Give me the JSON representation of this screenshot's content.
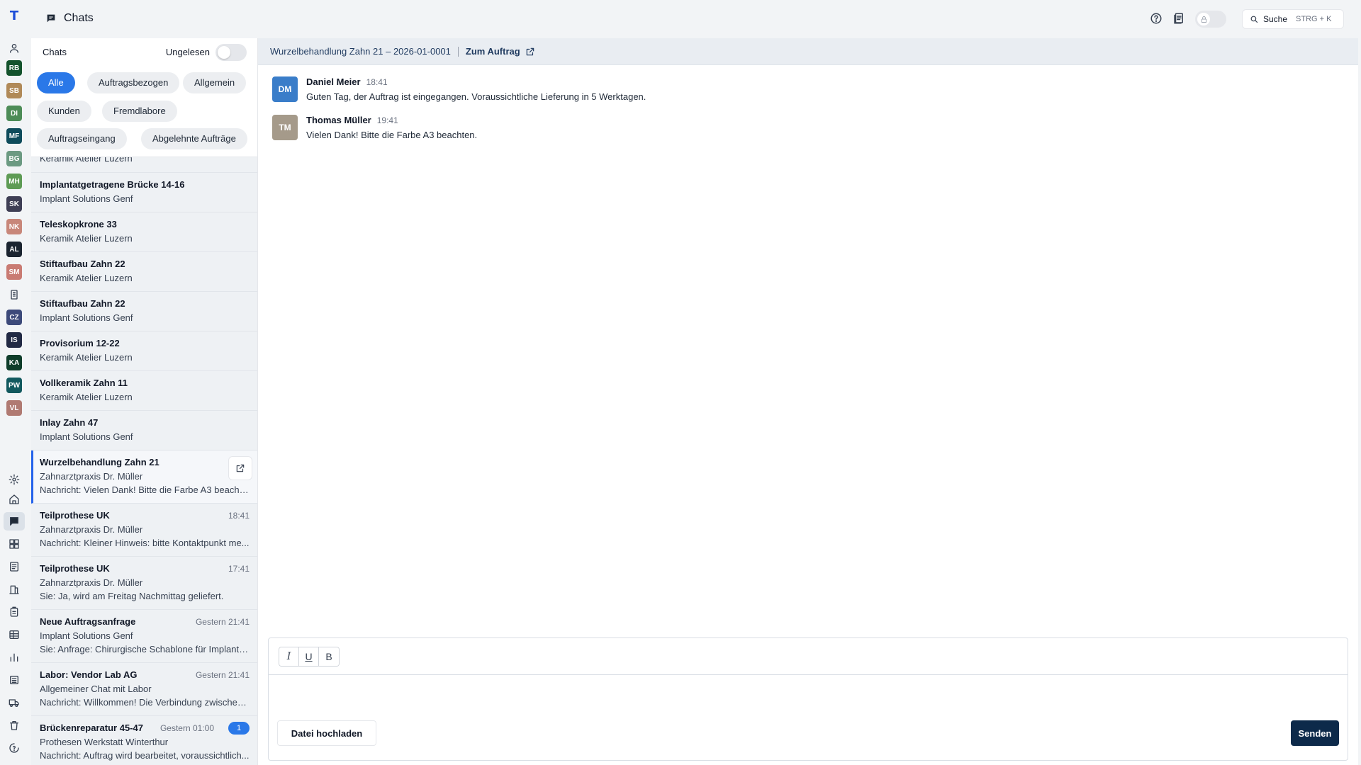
{
  "app": {
    "logo_letter": "T"
  },
  "header": {
    "title": "Chats",
    "search_label": "Suche",
    "search_shortcut": "STRG + K"
  },
  "rail": {
    "avatars": [
      {
        "initials": "RB",
        "color": "#14532d",
        "dot": false
      },
      {
        "initials": "SB",
        "color": "#b08958",
        "dot": false
      },
      {
        "initials": "DI",
        "color": "#4d8c57",
        "dot": false
      },
      {
        "initials": "MF",
        "color": "#0f4c5c",
        "dot": false
      },
      {
        "initials": "BG",
        "color": "#6c9a82",
        "dot": false
      },
      {
        "initials": "MH",
        "color": "#5e9b54",
        "dot": false
      },
      {
        "initials": "SK",
        "color": "#3f3f55",
        "dot": false
      },
      {
        "initials": "NK",
        "color": "#c8877a",
        "dot": false
      },
      {
        "initials": "AL",
        "color": "#1b2430",
        "dot": false
      },
      {
        "initials": "SM",
        "color": "#c97b73",
        "dot": false
      },
      {
        "initials": "CZ",
        "color": "#3d4a7a",
        "dot": false
      },
      {
        "initials": "IS",
        "color": "#222a44",
        "dot": true
      },
      {
        "initials": "KA",
        "color": "#0f3d2a",
        "dot": true
      },
      {
        "initials": "PW",
        "color": "#12595e",
        "dot": true
      },
      {
        "initials": "VL",
        "color": "#b07a72",
        "dot": true
      }
    ]
  },
  "list": {
    "title": "Chats",
    "unread_label": "Ungelesen",
    "filters": [
      "Alle",
      "Auftragsbezogen",
      "Allgemein",
      "Kunden",
      "Fremdlabore",
      "Auftragseingang",
      "Abgelehnte Aufträge"
    ],
    "partial_sub": "Keramik Atelier Luzern",
    "items": [
      {
        "title": "Implantatgetragene Brücke 14-16",
        "sub": "Implant Solutions Genf"
      },
      {
        "title": "Teleskopkrone 33",
        "sub": "Keramik Atelier Luzern"
      },
      {
        "title": "Stiftaufbau Zahn 22",
        "sub": "Keramik Atelier Luzern"
      },
      {
        "title": "Stiftaufbau Zahn 22",
        "sub": "Implant Solutions Genf"
      },
      {
        "title": "Provisorium 12-22",
        "sub": "Keramik Atelier Luzern"
      },
      {
        "title": "Vollkeramik Zahn 11",
        "sub": "Keramik Atelier Luzern"
      },
      {
        "title": "Inlay Zahn 47",
        "sub": "Implant Solutions Genf"
      }
    ],
    "selected": {
      "title": "Wurzelbehandlung Zahn 21",
      "sub": "Zahnarztpraxis Dr. Müller",
      "msg": "Nachricht: Vielen Dank! Bitte die Farbe A3 beachten."
    },
    "rich_items": [
      {
        "title": "Teilprothese UK",
        "time": "18:41",
        "sub": "Zahnarztpraxis Dr. Müller",
        "msg": "Nachricht: Kleiner Hinweis: bitte Kontaktpunkt me..."
      },
      {
        "title": "Teilprothese UK",
        "time": "17:41",
        "sub": "Zahnarztpraxis Dr. Müller",
        "msg": "Sie: Ja, wird am Freitag Nachmittag geliefert."
      },
      {
        "title": "Neue Auftragsanfrage",
        "time": "Gestern 21:41",
        "sub": "Implant Solutions Genf",
        "msg": "Sie: Anfrage: Chirurgische Schablone für Implantat..."
      },
      {
        "title": "Labor: Vendor Lab AG",
        "time": "Gestern 21:41",
        "sub": "Allgemeiner Chat mit Labor",
        "msg": "Nachricht: Willkommen! Die Verbindung zwischen ..."
      },
      {
        "title": "Brückenreparatur 45-47",
        "time": "Gestern 01:00",
        "badge": "1",
        "sub": "Prothesen Werkstatt Winterthur",
        "msg": "Nachricht: Auftrag wird bearbeitet, voraussichtlich..."
      }
    ]
  },
  "conversation": {
    "order_title": "Wurzelbehandlung Zahn 21 – 2026-01-0001",
    "order_link": "Zum Auftrag",
    "messages": [
      {
        "initials": "DM",
        "color": "#3a7dc9",
        "name": "Daniel Meier",
        "time": "18:41",
        "text": "Guten Tag, der Auftrag ist eingegangen. Voraussichtliche Lieferung in 5 Werktagen."
      },
      {
        "initials": "TM",
        "color": "#a59a8a",
        "name": "Thomas Müller",
        "time": "19:41",
        "text": "Vielen Dank! Bitte die Farbe A3 beachten."
      }
    ]
  },
  "composer": {
    "italic": "I",
    "underline": "U",
    "bold": "B",
    "upload_label": "Datei hochladen",
    "send_label": "Senden"
  }
}
